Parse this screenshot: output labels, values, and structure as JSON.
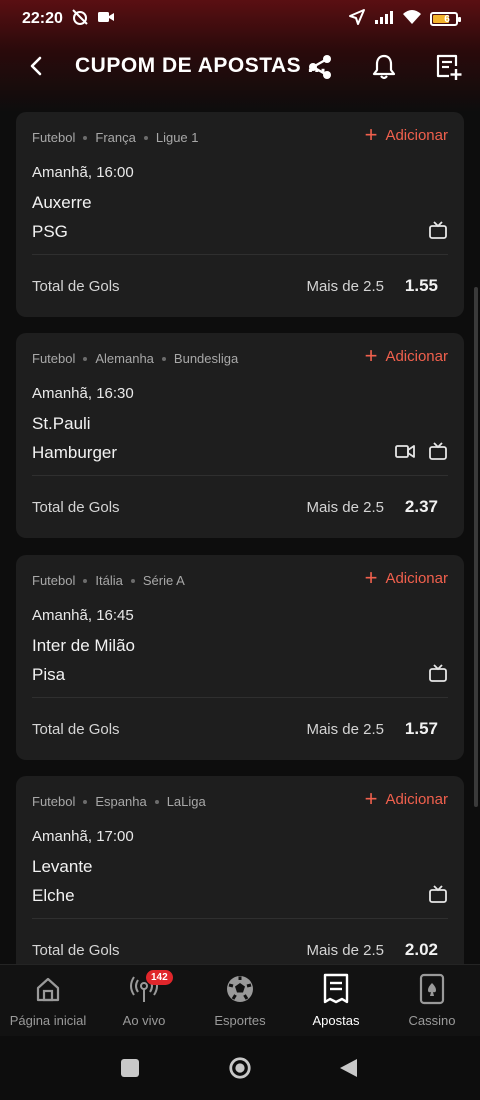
{
  "status_bar": {
    "time": "22:20",
    "battery": "6"
  },
  "header": {
    "title": "CUPOM DE APOSTAS ..."
  },
  "cards": [
    {
      "sport": "Futebol",
      "country": "França",
      "league": "Ligue 1",
      "add_label": "Adicionar",
      "time": "Amanhã, 16:00",
      "home": "Auxerre",
      "away": "PSG",
      "market": "Total de Gols",
      "selection": "Mais de 2.5",
      "odds": "1.55"
    },
    {
      "sport": "Futebol",
      "country": "Alemanha",
      "league": "Bundesliga",
      "add_label": "Adicionar",
      "time": "Amanhã, 16:30",
      "home": "St.Pauli",
      "away": "Hamburger",
      "market": "Total de Gols",
      "selection": "Mais de 2.5",
      "odds": "2.37"
    },
    {
      "sport": "Futebol",
      "country": "Itália",
      "league": "Série A",
      "add_label": "Adicionar",
      "time": "Amanhã, 16:45",
      "home": "Inter de Milão",
      "away": "Pisa",
      "market": "Total de Gols",
      "selection": "Mais de 2.5",
      "odds": "1.57"
    },
    {
      "sport": "Futebol",
      "country": "Espanha",
      "league": "LaLiga",
      "add_label": "Adicionar",
      "time": "Amanhã, 17:00",
      "home": "Levante",
      "away": "Elche",
      "market": "Total de Gols",
      "selection": "Mais de 2.5",
      "odds": "2.02"
    }
  ],
  "bottom_nav": {
    "items": [
      {
        "label": "Página inicial",
        "icon": "home-icon"
      },
      {
        "label": "Ao vivo",
        "icon": "live-broadcast-icon",
        "badge": "142"
      },
      {
        "label": "Esportes",
        "icon": "soccer-ball-icon"
      },
      {
        "label": "Apostas",
        "icon": "bet-slip-icon",
        "active": true
      },
      {
        "label": "Cassino",
        "icon": "playing-card-icon"
      }
    ]
  },
  "colors": {
    "accent": "#f0604d",
    "card_bg": "#1e1e1e",
    "background": "#0d0d0d",
    "badge": "#e0262b"
  }
}
